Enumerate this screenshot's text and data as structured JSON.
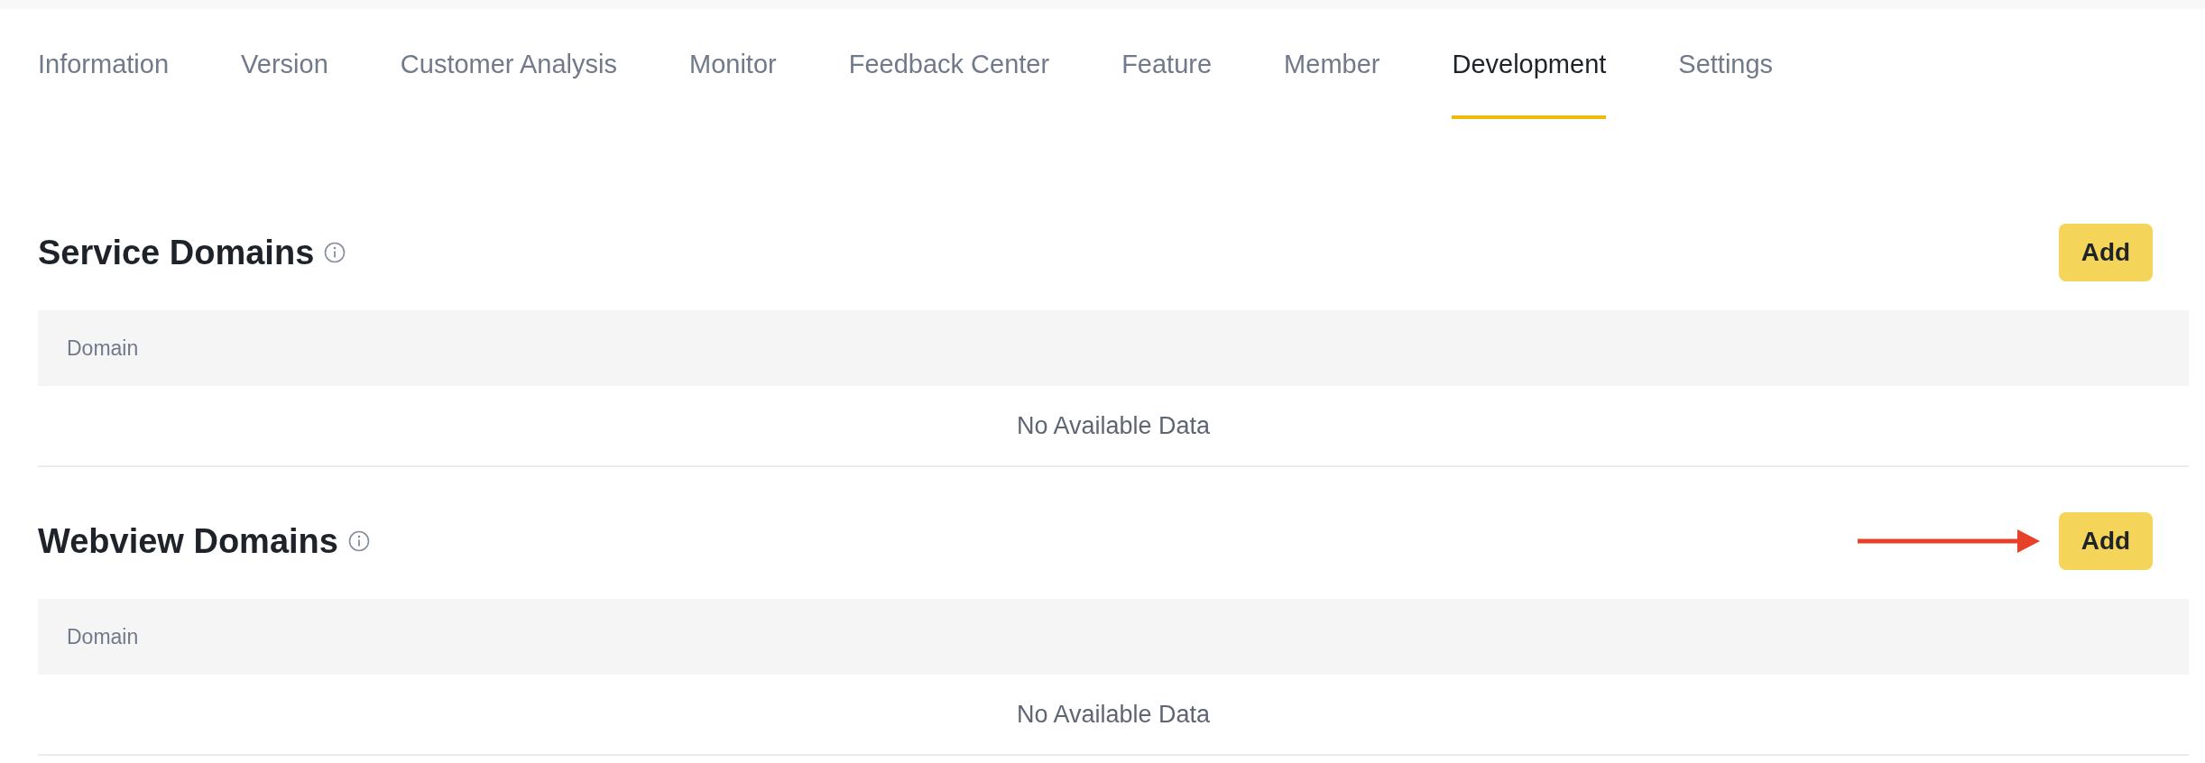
{
  "tabs": [
    {
      "label": "Information",
      "selected": false
    },
    {
      "label": "Version",
      "selected": false
    },
    {
      "label": "Customer Analysis",
      "selected": false
    },
    {
      "label": "Monitor",
      "selected": false
    },
    {
      "label": "Feedback Center",
      "selected": false
    },
    {
      "label": "Feature",
      "selected": false
    },
    {
      "label": "Member",
      "selected": false
    },
    {
      "label": "Development",
      "selected": true
    },
    {
      "label": "Settings",
      "selected": false
    }
  ],
  "sections": [
    {
      "title": "Service Domains",
      "add_button": "Add",
      "pointer_arrow": false,
      "table": {
        "columns": [
          "Domain"
        ],
        "empty_text": "No Available Data"
      }
    },
    {
      "title": "Webview Domains",
      "add_button": "Add",
      "pointer_arrow": true,
      "table": {
        "columns": [
          "Domain"
        ],
        "empty_text": "No Available Data"
      }
    }
  ]
}
